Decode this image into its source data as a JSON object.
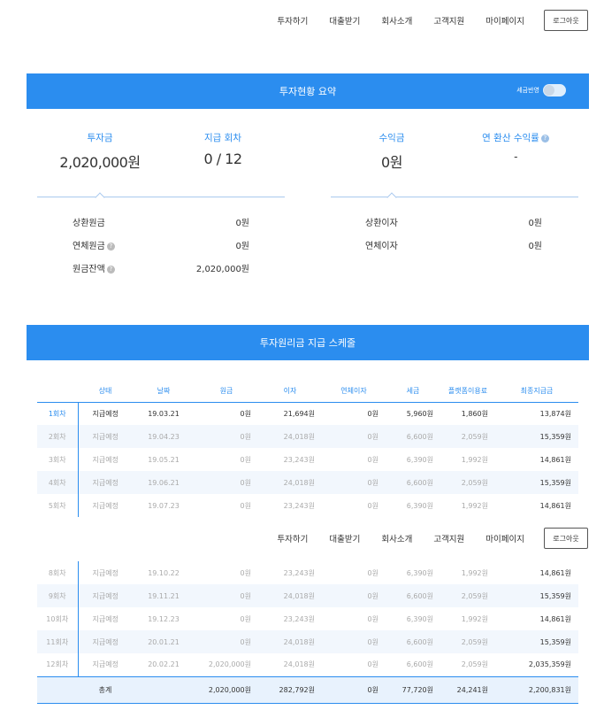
{
  "nav": {
    "links": [
      "투자하기",
      "대출받기",
      "회사소개",
      "고객지원",
      "마이페이지"
    ],
    "logout": "로그아웃"
  },
  "summary": {
    "title": "투자현황 요약",
    "toggle_label": "세금반영",
    "invest_label": "투자금",
    "invest_value": "2,020,000원",
    "round_label": "지급 회차",
    "round_value": "0 / 12",
    "profit_label": "수익금",
    "profit_value": "0원",
    "yield_label": "연 환산 수익률",
    "yield_value": "-",
    "left_rows": [
      {
        "label": "상환원금",
        "value": "0원"
      },
      {
        "label": "연체원금",
        "value": "0원"
      },
      {
        "label": "원금잔액",
        "value": "2,020,000원"
      }
    ],
    "right_rows": [
      {
        "label": "상환이자",
        "value": "0원"
      },
      {
        "label": "연체이자",
        "value": "0원"
      }
    ]
  },
  "schedule": {
    "title": "투자원리금 지급 스케줄",
    "headers": [
      "",
      "상태",
      "날짜",
      "원금",
      "이자",
      "연체이자",
      "세금",
      "플랫폼이용료",
      "최종지급금"
    ],
    "rows_top": [
      [
        "1회차",
        "지급예정",
        "19.03.21",
        "0원",
        "21,694원",
        "0원",
        "5,960원",
        "1,860원",
        "13,874원"
      ],
      [
        "2회차",
        "지급예정",
        "19.04.23",
        "0원",
        "24,018원",
        "0원",
        "6,600원",
        "2,059원",
        "15,359원"
      ],
      [
        "3회차",
        "지급예정",
        "19.05.21",
        "0원",
        "23,243원",
        "0원",
        "6,390원",
        "1,992원",
        "14,861원"
      ],
      [
        "4회차",
        "지급예정",
        "19.06.21",
        "0원",
        "24,018원",
        "0원",
        "6,600원",
        "2,059원",
        "15,359원"
      ],
      [
        "5회차",
        "지급예정",
        "19.07.23",
        "0원",
        "23,243원",
        "0원",
        "6,390원",
        "1,992원",
        "14,861원"
      ]
    ],
    "rows_bottom": [
      [
        "8회차",
        "지급예정",
        "19.10.22",
        "0원",
        "23,243원",
        "0원",
        "6,390원",
        "1,992원",
        "14,861원"
      ],
      [
        "9회차",
        "지급예정",
        "19.11.21",
        "0원",
        "24,018원",
        "0원",
        "6,600원",
        "2,059원",
        "15,359원"
      ],
      [
        "10회차",
        "지급예정",
        "19.12.23",
        "0원",
        "23,243원",
        "0원",
        "6,390원",
        "1,992원",
        "14,861원"
      ],
      [
        "11회차",
        "지급예정",
        "20.01.21",
        "0원",
        "24,018원",
        "0원",
        "6,600원",
        "2,059원",
        "15,359원"
      ],
      [
        "12회차",
        "지급예정",
        "20.02.21",
        "2,020,000원",
        "24,018원",
        "0원",
        "6,600원",
        "2,059원",
        "2,035,359원"
      ]
    ],
    "total": [
      "",
      "총계",
      "",
      "2,020,000원",
      "282,792원",
      "0원",
      "77,720원",
      "24,241원",
      "2,200,831원"
    ]
  }
}
